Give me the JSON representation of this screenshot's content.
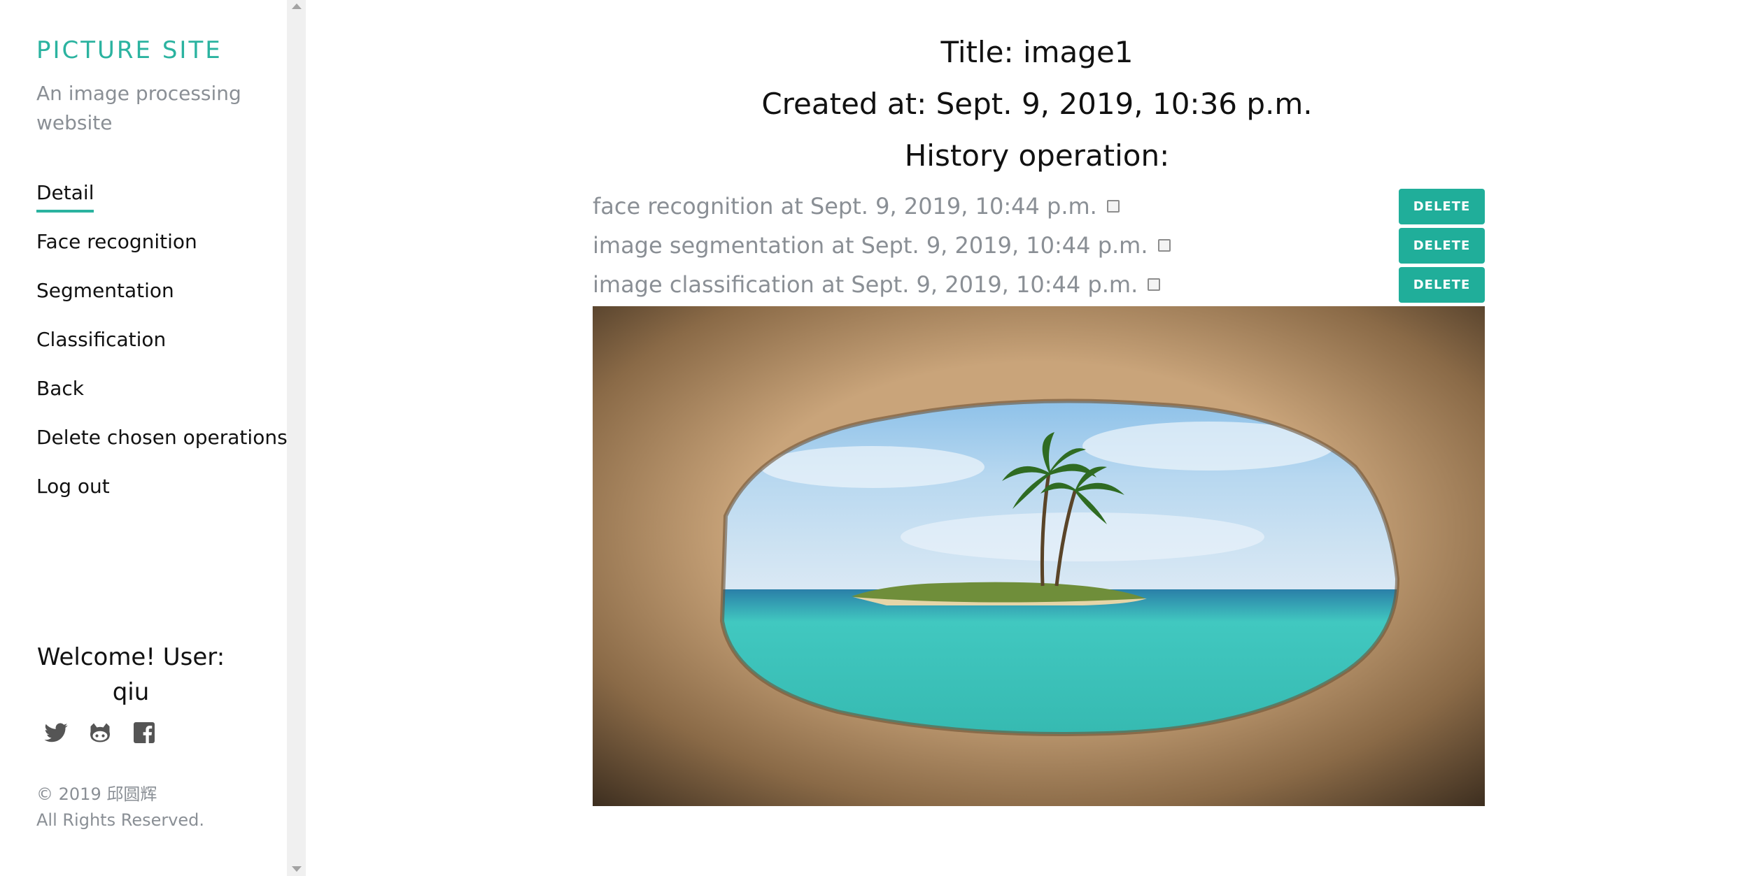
{
  "sidebar": {
    "brand": "PICTURE SITE",
    "tagline": "An image processing website",
    "nav": [
      {
        "label": "Detail"
      },
      {
        "label": "Face recognition"
      },
      {
        "label": "Segmentation"
      },
      {
        "label": "Classification"
      },
      {
        "label": "Back"
      },
      {
        "label": "Delete chosen operations"
      },
      {
        "label": "Log out"
      }
    ],
    "welcome_line1": "Welcome! User:",
    "welcome_user": "qiu",
    "social_icons": [
      "twitter-icon",
      "github-icon",
      "facebook-icon"
    ],
    "footer_line1": "© 2019 邱圆辉",
    "footer_line2": "All Rights Reserved."
  },
  "main": {
    "title": "Title: image1",
    "created": "Created at: Sept. 9, 2019, 10:36 p.m.",
    "history_label": "History operation:",
    "operations": [
      {
        "text": "face recognition at Sept. 9, 2019, 10:44 p.m.",
        "checked": false,
        "button": "DELETE"
      },
      {
        "text": "image segmentation at Sept. 9, 2019, 10:44 p.m.",
        "checked": false,
        "button": "DELETE"
      },
      {
        "text": "image classification at Sept. 9, 2019, 10:44 p.m.",
        "checked": false,
        "button": "DELETE"
      }
    ]
  },
  "colors": {
    "accent": "#2bb3a0",
    "button": "#20ae9a",
    "muted": "#8a8f95"
  }
}
